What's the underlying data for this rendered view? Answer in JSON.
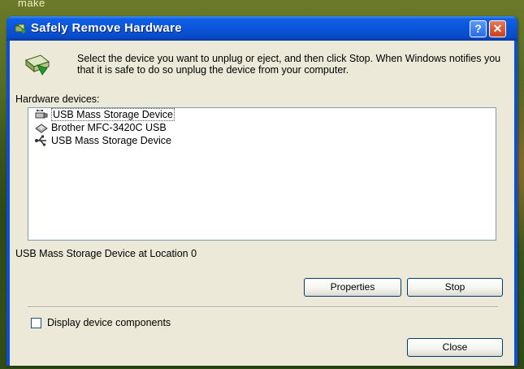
{
  "desktop": {
    "partial_text": "make"
  },
  "window": {
    "title": "Safely Remove Hardware",
    "help_label": "?",
    "close_label": "✕"
  },
  "intro": {
    "text": "Select the device you want to unplug or eject, and then click Stop. When Windows notifies you that it is safe to do so unplug the device from your computer."
  },
  "hardware": {
    "label": "Hardware devices:",
    "devices": [
      {
        "label": "USB Mass Storage Device",
        "icon": "usb-storage-icon"
      },
      {
        "label": "Brother MFC-3420C USB",
        "icon": "printer-device-icon"
      },
      {
        "label": "USB Mass Storage Device",
        "icon": "usb-plug-icon"
      }
    ]
  },
  "status": {
    "location": "USB Mass Storage Device at Location 0"
  },
  "buttons": {
    "properties": "Properties",
    "stop": "Stop",
    "close": "Close"
  },
  "options": {
    "display_components": "Display device components"
  }
}
